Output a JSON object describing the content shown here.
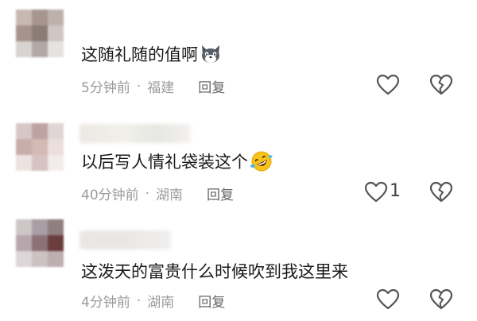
{
  "comments": [
    {
      "text": "这随礼随的值啊",
      "emoji": "wolf-emoji",
      "time": "5分钟前",
      "location": "福建",
      "reply_label": "回复",
      "likes": ""
    },
    {
      "text": "以后写人情礼袋装这个",
      "emoji": "rofl-emoji",
      "time": "40分钟前",
      "location": "湖南",
      "reply_label": "回复",
      "likes": "1"
    },
    {
      "text": "这泼天的富贵什么时候吹到我这里来",
      "emoji": "",
      "time": "4分钟前",
      "location": "湖南",
      "reply_label": "回复",
      "likes": ""
    }
  ],
  "meta_separator": "·",
  "colors": {
    "text": "#1a1a1a",
    "meta": "#9b9b9b",
    "icon": "#555555"
  }
}
